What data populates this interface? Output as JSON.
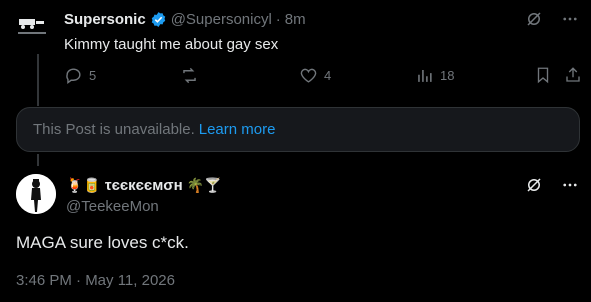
{
  "post1": {
    "display_name": "Supersonic",
    "handle": "@Supersonicyl",
    "separator": "·",
    "time": "8m",
    "text": "Kimmy taught me about gay sex",
    "replies": "5",
    "reposts": "",
    "likes": "4",
    "views": "18"
  },
  "unavailable": {
    "message": "This Post is unavailable.",
    "link": "Learn more"
  },
  "post2": {
    "emoji_left": "🍹🥫",
    "display_name": "τєєкєємσн",
    "emoji_right": "🌴🍸",
    "handle": "@TeekeeMon",
    "text": "MAGA sure loves c*ck.",
    "timestamp": "3:46 PM · May 11, 2026"
  },
  "colors": {
    "background": "#000000",
    "text": "#e7e9ea",
    "muted": "#71767b",
    "link": "#1d9bf0",
    "verified": "#1d9bf0"
  }
}
